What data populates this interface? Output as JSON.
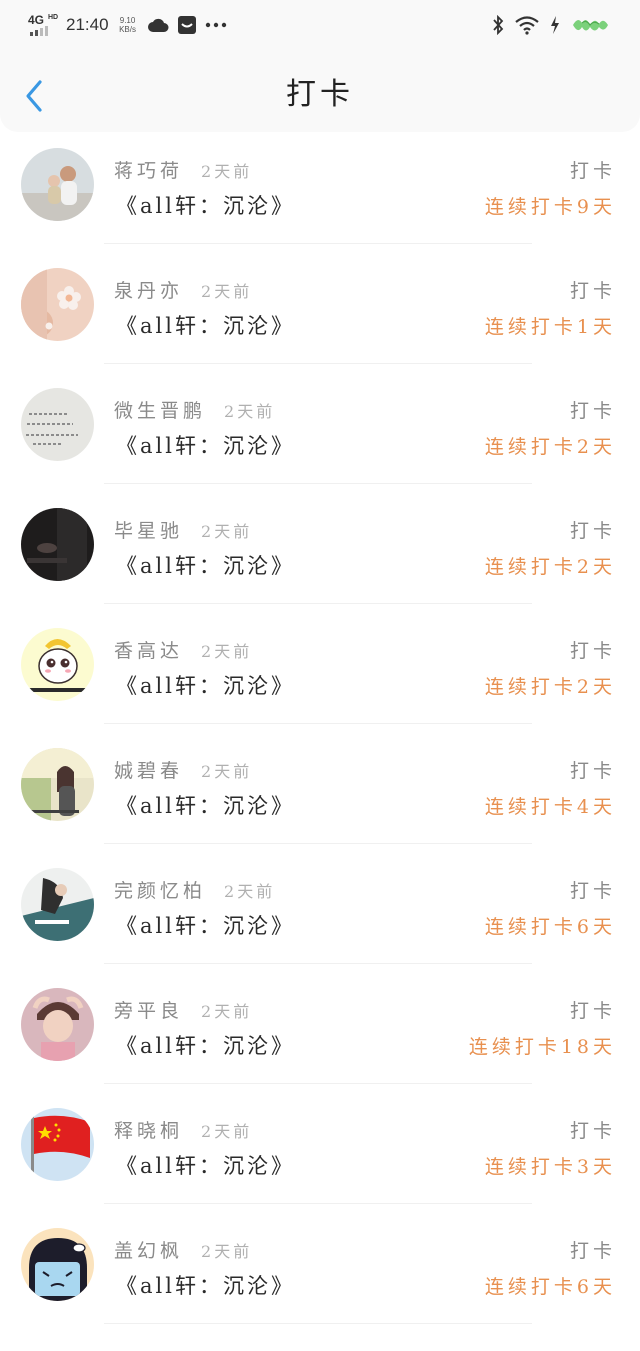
{
  "status_bar": {
    "network": "4G",
    "network_badge": "HD",
    "time": "21:40",
    "speed_value": "9.10",
    "speed_unit": "KB/s",
    "icons": [
      "cloud-icon",
      "message-icon",
      "more-icon",
      "bluetooth-icon",
      "wifi-icon",
      "charging-icon",
      "battery-icon"
    ]
  },
  "nav": {
    "title": "打卡",
    "back_icon": "chevron-left-icon",
    "accent_color": "#3a98e3"
  },
  "colors": {
    "name": "#8a8a8a",
    "time": "#b0b0b0",
    "streak": "#e8904f"
  },
  "items": [
    {
      "name": "蒋巧荷",
      "time": "2天前",
      "book": "《all轩：沉沦》",
      "action": "打卡",
      "streak": "连续打卡9天",
      "avatar": "avatar-photo-parent-child"
    },
    {
      "name": "泉丹亦",
      "time": "2天前",
      "book": "《all轩：沉沦》",
      "action": "打卡",
      "streak": "连续打卡1天",
      "avatar": "avatar-flower"
    },
    {
      "name": "微生晋鹏",
      "time": "2天前",
      "book": "《all轩：沉沦》",
      "action": "打卡",
      "streak": "连续打卡2天",
      "avatar": "avatar-handwriting"
    },
    {
      "name": "毕星驰",
      "time": "2天前",
      "book": "《all轩：沉沦》",
      "action": "打卡",
      "streak": "连续打卡2天",
      "avatar": "avatar-dark-photo"
    },
    {
      "name": "香高达",
      "time": "2天前",
      "book": "《all轩：沉沦》",
      "action": "打卡",
      "streak": "连续打卡2天",
      "avatar": "avatar-cartoon"
    },
    {
      "name": "娍碧春",
      "time": "2天前",
      "book": "《all轩：沉沦》",
      "action": "打卡",
      "streak": "连续打卡4天",
      "avatar": "avatar-girl-sunlight"
    },
    {
      "name": "完颜忆柏",
      "time": "2天前",
      "book": "《all轩：沉沦》",
      "action": "打卡",
      "streak": "连续打卡6天",
      "avatar": "avatar-girl-teal"
    },
    {
      "name": "旁平良",
      "time": "2天前",
      "book": "《all轩：沉沦》",
      "action": "打卡",
      "streak": "连续打卡18天",
      "avatar": "avatar-boy"
    },
    {
      "name": "释晓桐",
      "time": "2天前",
      "book": "《all轩：沉沦》",
      "action": "打卡",
      "streak": "连续打卡3天",
      "avatar": "avatar-flag"
    },
    {
      "name": "盖幻枫",
      "time": "2天前",
      "book": "《all轩：沉沦》",
      "action": "打卡",
      "streak": "连续打卡6天",
      "avatar": "avatar-cartoon-girl"
    }
  ]
}
